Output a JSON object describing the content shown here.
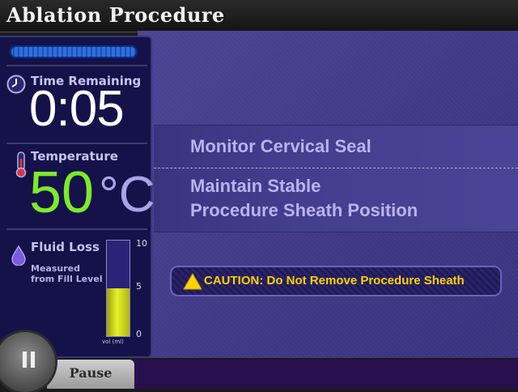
{
  "header": {
    "title": "Ablation Procedure"
  },
  "progress": {
    "fraction": 1.0
  },
  "time": {
    "label": "Time Remaining",
    "value": "0:05"
  },
  "temperature": {
    "label": "Temperature",
    "value": "50",
    "unit": "°C"
  },
  "fluid": {
    "label": "Fluid Loss",
    "sub_label": "Measured from Fill Level",
    "ticks": [
      "10",
      "5",
      "0"
    ],
    "unit_label": "vol (ml)",
    "level_fraction": 0.5
  },
  "steps": [
    {
      "lines": [
        "Monitor Cervical Seal"
      ]
    },
    {
      "lines": [
        "Maintain Stable",
        "Procedure Sheath Position"
      ]
    }
  ],
  "caution": {
    "text": "CAUTION: Do Not Remove Procedure Sheath"
  },
  "controls": {
    "pause_label": "Pause"
  },
  "colors": {
    "temperature": "#7dea2b",
    "caution": "#ffd200",
    "gauge_fill": "#e7ef29"
  }
}
